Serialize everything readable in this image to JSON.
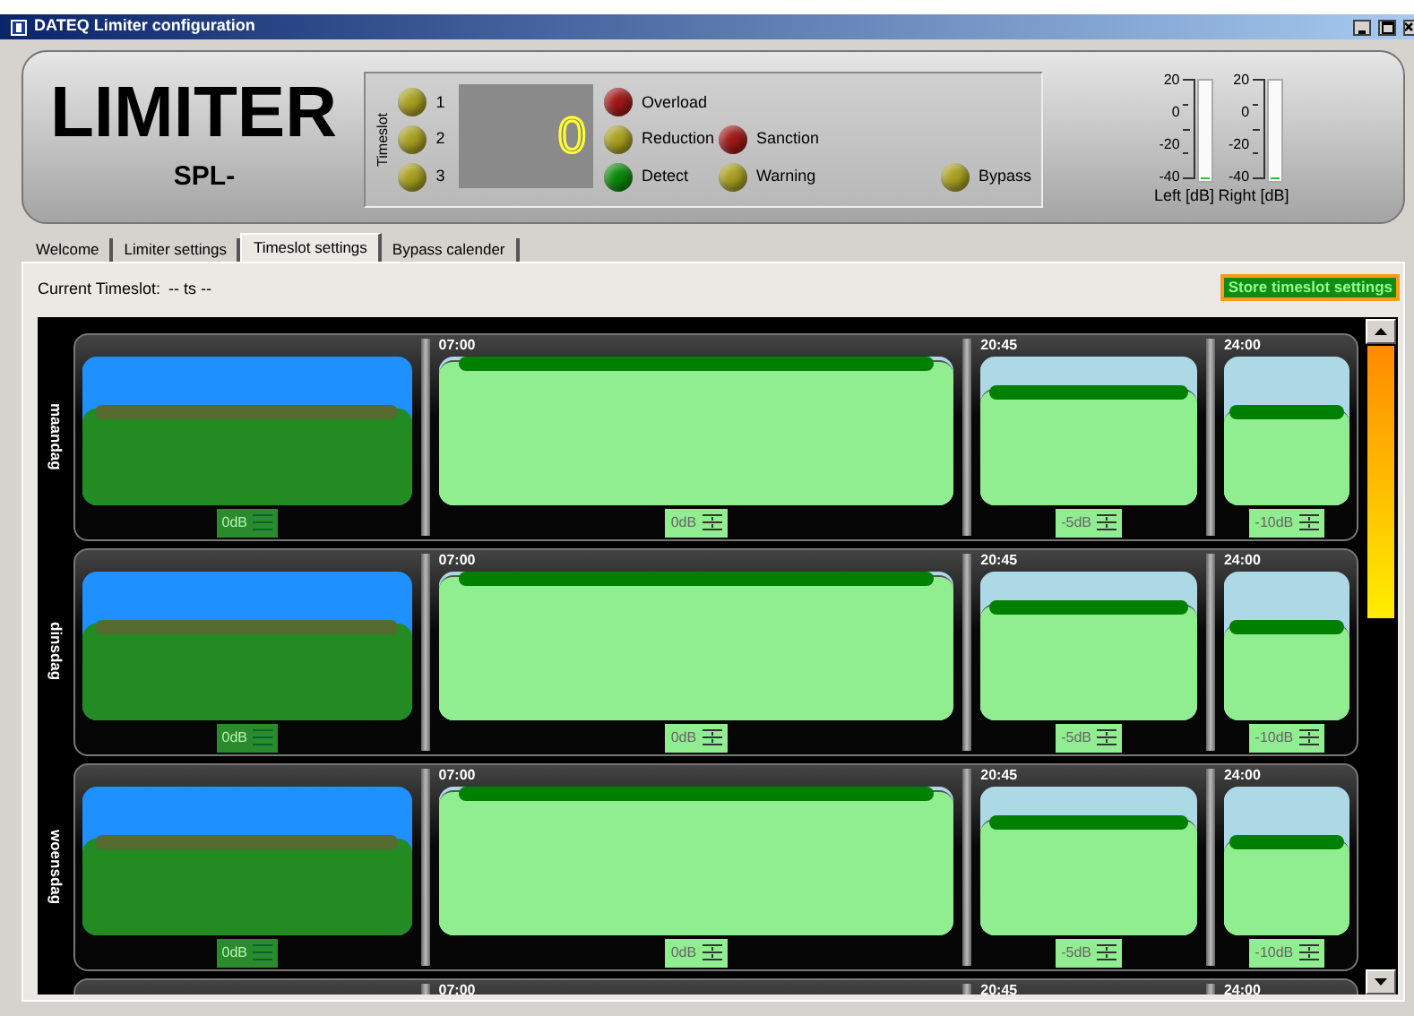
{
  "window": {
    "title": "DATEQ Limiter configuration"
  },
  "header": {
    "title": "LIMITER",
    "subtitle": "SPL-"
  },
  "status": {
    "timeslot_label": "Timeslot",
    "timeslots": [
      {
        "label": "1",
        "color": "#a8a020"
      },
      {
        "label": "2",
        "color": "#a8a020"
      },
      {
        "label": "3",
        "color": "#a8a020"
      }
    ],
    "display": "0",
    "indicator_columns": [
      [
        {
          "label": "Overload",
          "color": "#a01818"
        },
        {
          "label": "Reduction",
          "color": "#a8a020"
        },
        {
          "label": "Detect",
          "color": "#0a8a0a"
        }
      ],
      [
        {
          "label": "Sanction",
          "color": "#a01818"
        },
        {
          "label": "Warning",
          "color": "#a8a020"
        }
      ],
      [
        {
          "label": "Bypass",
          "color": "#a8a020"
        }
      ]
    ]
  },
  "meters": [
    {
      "label": "Left [dB]",
      "ticks": [
        "20",
        "0",
        "-20",
        "-40"
      ],
      "level": 0.02
    },
    {
      "label": "Right [dB]",
      "ticks": [
        "20",
        "0",
        "-20",
        "-40"
      ],
      "level": 0.02
    }
  ],
  "tabs": [
    {
      "label": "Welcome",
      "selected": false
    },
    {
      "label": "Limiter settings",
      "selected": false
    },
    {
      "label": "Timeslot settings",
      "selected": true
    },
    {
      "label": "Bypass calender",
      "selected": false
    }
  ],
  "current_timeslot": {
    "label": "Current Timeslot:",
    "value": "-- ts --"
  },
  "store_button": "Store timeslot settings",
  "days": [
    {
      "name": "maandag",
      "slots": [
        {
          "selected": true,
          "level": 0.65,
          "value": "0dB"
        },
        {
          "time": "07:00",
          "selected": false,
          "level": 0.97,
          "value": "0dB"
        },
        {
          "time": "20:45",
          "selected": false,
          "level": 0.78,
          "value": "-5dB"
        },
        {
          "time": "24:00",
          "selected": false,
          "level": 0.64,
          "value": "-10dB"
        }
      ]
    },
    {
      "name": "dinsdag",
      "slots": [
        {
          "selected": true,
          "level": 0.65,
          "value": "0dB"
        },
        {
          "time": "07:00",
          "selected": false,
          "level": 0.97,
          "value": "0dB"
        },
        {
          "time": "20:45",
          "selected": false,
          "level": 0.78,
          "value": "-5dB"
        },
        {
          "time": "24:00",
          "selected": false,
          "level": 0.64,
          "value": "-10dB"
        }
      ]
    },
    {
      "name": "woensdag",
      "slots": [
        {
          "selected": true,
          "level": 0.65,
          "value": "0dB"
        },
        {
          "time": "07:00",
          "selected": false,
          "level": 0.97,
          "value": "0dB"
        },
        {
          "time": "20:45",
          "selected": false,
          "level": 0.78,
          "value": "-5dB"
        },
        {
          "time": "24:00",
          "selected": false,
          "level": 0.64,
          "value": "-10dB"
        }
      ]
    }
  ],
  "next_day_partial": {
    "slot_times": [
      "07:00",
      "20:45",
      "24:00"
    ]
  }
}
